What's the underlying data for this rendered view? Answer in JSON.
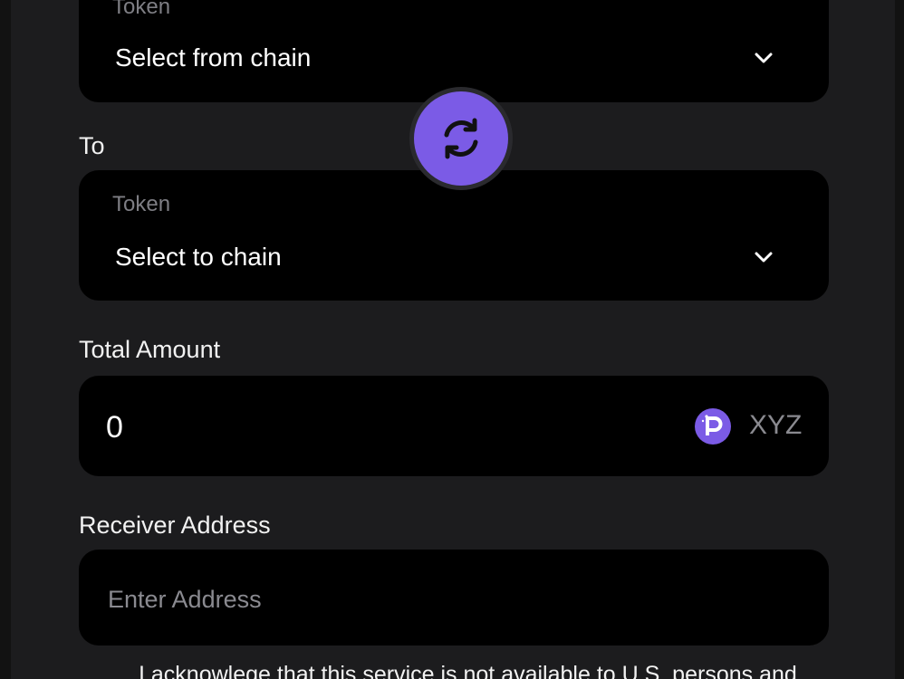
{
  "from": {
    "token_label": "Token",
    "value": "Select from chain"
  },
  "to": {
    "section_label": "To",
    "token_label": "Token",
    "value": "Select to chain"
  },
  "amount": {
    "section_label": "Total Amount",
    "value": "0",
    "token_symbol": "XYZ"
  },
  "address": {
    "section_label": "Receiver Address",
    "placeholder": "Enter Address"
  },
  "disclaimer": {
    "text": "I acknowlege that this service is not available to U.S. persons and"
  },
  "icons": {
    "swap": "swap-arrows-icon",
    "chevron": "chevron-down-icon",
    "token": "token-p-icon"
  },
  "colors": {
    "accent": "#7b5be6",
    "background": "#1c1c1e",
    "field": "#000000",
    "muted_text": "#7e7e84"
  }
}
